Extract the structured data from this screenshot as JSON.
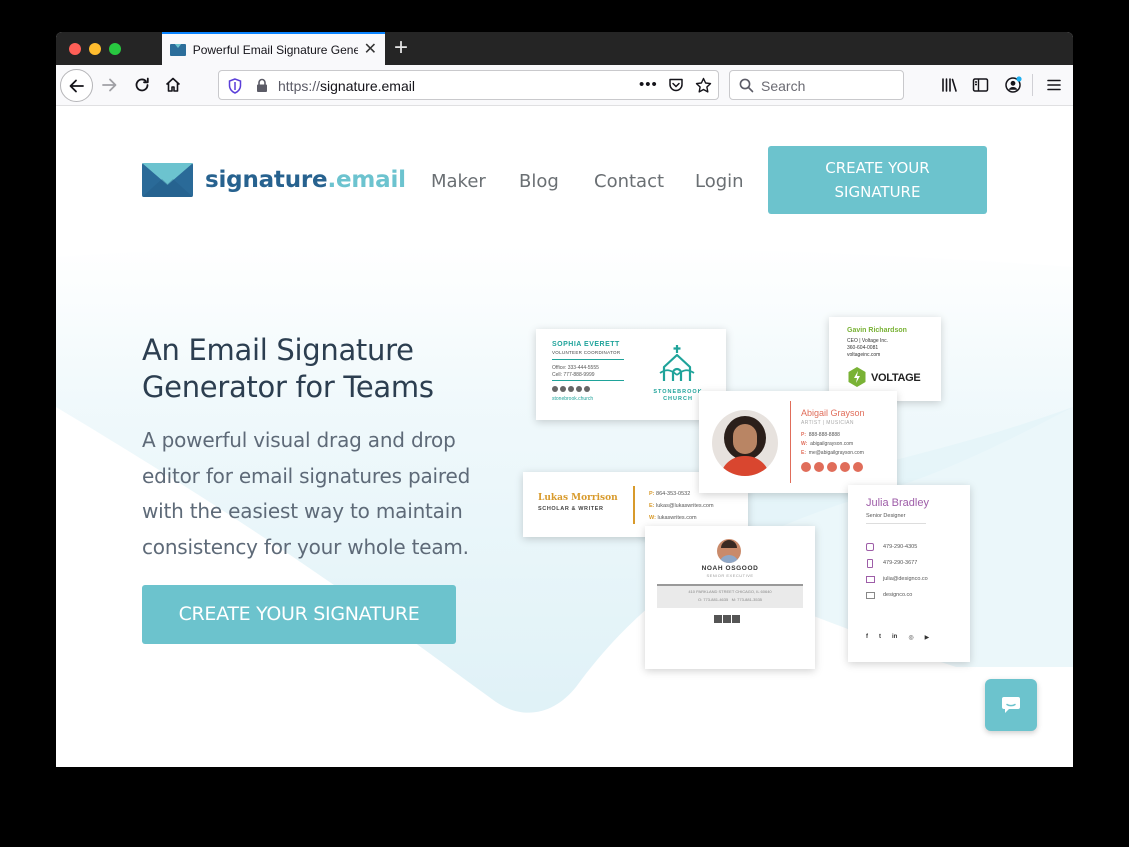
{
  "browser": {
    "tab_title": "Powerful Email Signature Generator for Teams",
    "url_protocol": "https://",
    "url_host": "signature.email",
    "search_placeholder": "Search"
  },
  "header": {
    "logo_main": "signature",
    "logo_dot": ".email",
    "nav": [
      "Maker",
      "Blog",
      "Contact",
      "Login"
    ],
    "cta_line1": "CREATE YOUR",
    "cta_line2": "SIGNATURE"
  },
  "hero": {
    "title_line1": "An Email Signature",
    "title_line2": "Generator for Teams",
    "subtitle_lines": [
      "A powerful visual drag and drop",
      "editor for email signatures paired",
      "with the easiest way to maintain",
      "consistency for your whole team."
    ],
    "cta": "CREATE YOUR SIGNATURE"
  },
  "cards": {
    "sophia": {
      "name": "SOPHIA EVERETT",
      "role": "VOLUNTEER COORDINATOR",
      "office": "Office: 333-444-5555",
      "cell": "Cell: 777-888-9999",
      "site": "stonebrook.church",
      "org_line1": "STONEBROOK",
      "org_line2": "CHURCH"
    },
    "gavin": {
      "name": "Gavin Richardson",
      "title": "CEO | Voltage Inc.",
      "phone": "360-604-0081",
      "site": "voltageinc.com",
      "brand": "VOLTAGE"
    },
    "abigail": {
      "name": "Abigail Grayson",
      "role": "ARTIST | MUSICIAN",
      "p_label": "P:",
      "p": "888-888-8888",
      "w_label": "W:",
      "w": "abigailgrayson.com",
      "e_label": "E:",
      "e": "me@abigailgrayson.com"
    },
    "lukas": {
      "name": "Lukas Morrison",
      "role": "SCHOLAR & WRITER",
      "p_label": "P:",
      "p": "864-353-0532",
      "e_label": "E:",
      "e": "lukas@lukaswrites.com",
      "w_label": "W:",
      "w": "lukaswrites.com"
    },
    "julia": {
      "name": "Julia Bradley",
      "role": "Senior Designer",
      "phone1": "479-290-4305",
      "phone2": "479-290-3677",
      "email": "julia@designco.co",
      "site": "designco.co"
    },
    "noah": {
      "name": "NOAH OSGOOD",
      "role": "SENIOR EXECUTIVE",
      "address": "410 PARKLAND STREET CHICAGO, IL 60640",
      "o_phone": "O: 773-881-4635",
      "m_phone": "M: 773-881-3535"
    }
  },
  "colors": {
    "accent": "#6cc3cd",
    "brand_blue": "#27628f",
    "heading": "#2c3e50",
    "body": "#5e6a78"
  }
}
